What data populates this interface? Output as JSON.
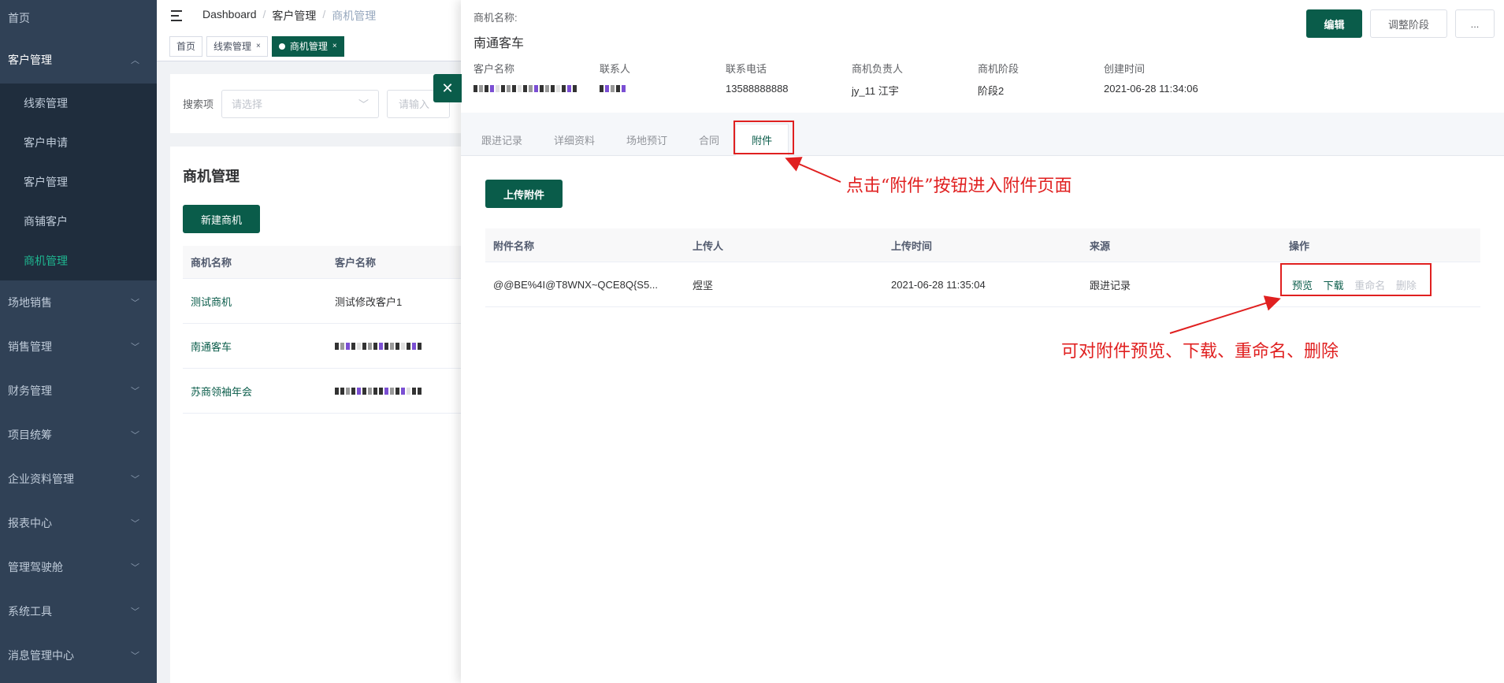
{
  "sidebar": {
    "items": [
      {
        "label": "首页"
      },
      {
        "label": "客户管理"
      },
      {
        "label": "场地销售"
      },
      {
        "label": "销售管理"
      },
      {
        "label": "财务管理"
      },
      {
        "label": "项目统筹"
      },
      {
        "label": "企业资料管理"
      },
      {
        "label": "报表中心"
      },
      {
        "label": "管理驾驶舱"
      },
      {
        "label": "系统工具"
      },
      {
        "label": "消息管理中心"
      }
    ],
    "sub_items": [
      {
        "label": "线索管理"
      },
      {
        "label": "客户申请"
      },
      {
        "label": "客户管理"
      },
      {
        "label": "商铺客户"
      },
      {
        "label": "商机管理"
      }
    ]
  },
  "navbar": {
    "breadcrumb": [
      "Dashboard",
      "客户管理",
      "商机管理"
    ],
    "separator": "/"
  },
  "tags": [
    {
      "label": "首页"
    },
    {
      "label": "线索管理"
    },
    {
      "label": "商机管理"
    }
  ],
  "search": {
    "label": "搜索项",
    "select_placeholder": "请选择",
    "input_placeholder": "请输入"
  },
  "list": {
    "title": "商机管理",
    "new_button": "新建商机",
    "headers": [
      "商机名称",
      "客户名称"
    ],
    "rows": [
      {
        "name": "测试商机",
        "customer": "测试修改客户1"
      },
      {
        "name": "南通客车",
        "customer": ""
      },
      {
        "name": "苏商领袖年会",
        "customer": ""
      }
    ]
  },
  "drawer": {
    "name_label": "商机名称:",
    "name": "南通客车",
    "buttons": {
      "edit": "编辑",
      "stage": "调整阶段",
      "more": "..."
    },
    "info_keys": [
      "客户名称",
      "联系人",
      "联系电话",
      "商机负责人",
      "商机阶段",
      "创建时间"
    ],
    "info_values": [
      "",
      "",
      "13588888888",
      "jy_11 江宇",
      "阶段2",
      "2021-06-28 11:34:06"
    ],
    "tabs": [
      "跟进记录",
      "详细资料",
      "场地预订",
      "合同",
      "附件"
    ],
    "upload_button": "上传附件",
    "table_headers": [
      "附件名称",
      "上传人",
      "上传时间",
      "来源",
      "操作"
    ],
    "attachments": [
      {
        "name": "@@BE%4I@T8WNX~QCE8Q{S5...",
        "uploader": "煜坚",
        "time": "2021-06-28 11:35:04",
        "source": "跟进记录"
      }
    ],
    "ops": [
      "预览",
      "下载",
      "重命名",
      "删除"
    ]
  },
  "annotations": {
    "tab_note": "点击“附件”按钮进入附件页面",
    "ops_note": "可对附件预览、下载、重命名、删除",
    "color": "#e02020"
  },
  "colors": {
    "accent": "#0a5c4a",
    "sidebar": "#304156",
    "active_menu": "#1fb590"
  }
}
